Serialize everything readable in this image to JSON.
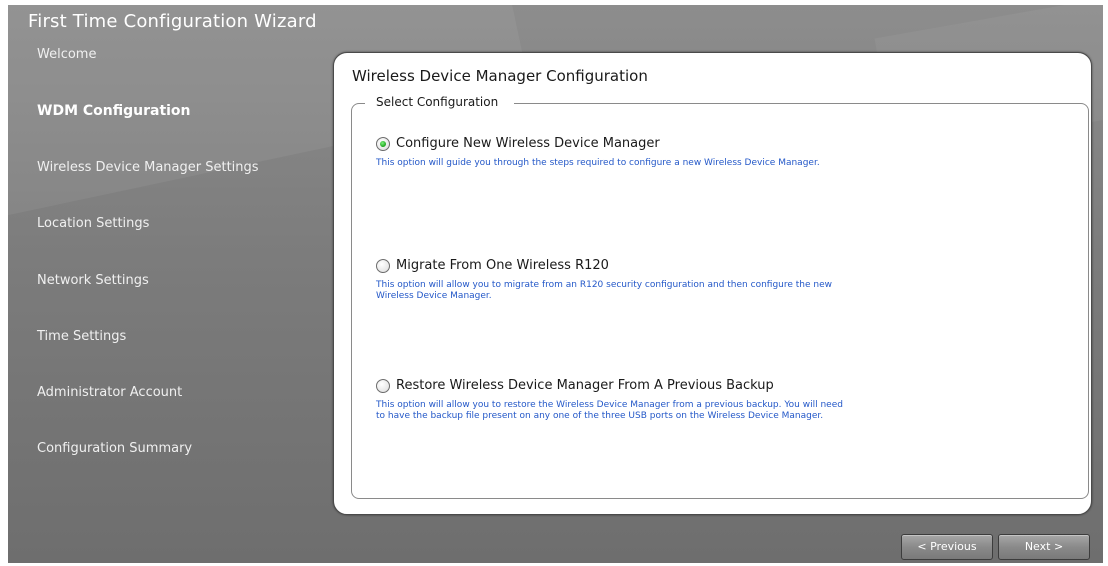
{
  "window": {
    "title": "First Time Configuration Wizard"
  },
  "nav": {
    "items": [
      {
        "label": "Welcome"
      },
      {
        "label": "WDM Configuration",
        "active": true
      },
      {
        "label": "Wireless Device Manager Settings"
      },
      {
        "label": "Location Settings"
      },
      {
        "label": "Network Settings"
      },
      {
        "label": "Time Settings"
      },
      {
        "label": "Administrator Account"
      },
      {
        "label": "Configuration Summary"
      }
    ]
  },
  "panel": {
    "title": "Wireless Device Manager Configuration",
    "group_label": "Select Configuration",
    "options": [
      {
        "label": "Configure New Wireless Device Manager",
        "selected": true,
        "description": "This option will guide you through the steps required to configure a new Wireless Device Manager."
      },
      {
        "label": "Migrate From One Wireless R120",
        "selected": false,
        "description": "This option will allow you to migrate from an R120 security configuration and then configure the new Wireless Device Manager."
      },
      {
        "label": "Restore Wireless Device Manager From A Previous Backup",
        "selected": false,
        "description": "This option will allow you to restore the Wireless Device Manager from a previous backup. You will need to have the backup file present on any one of the three USB ports on the Wireless Device Manager."
      }
    ]
  },
  "footer": {
    "previous_label": "< Previous",
    "next_label": "Next >"
  },
  "colors": {
    "accent_link": "#2458c8",
    "radio_selected": "#1da31d",
    "chrome": "#7c7c7c"
  }
}
